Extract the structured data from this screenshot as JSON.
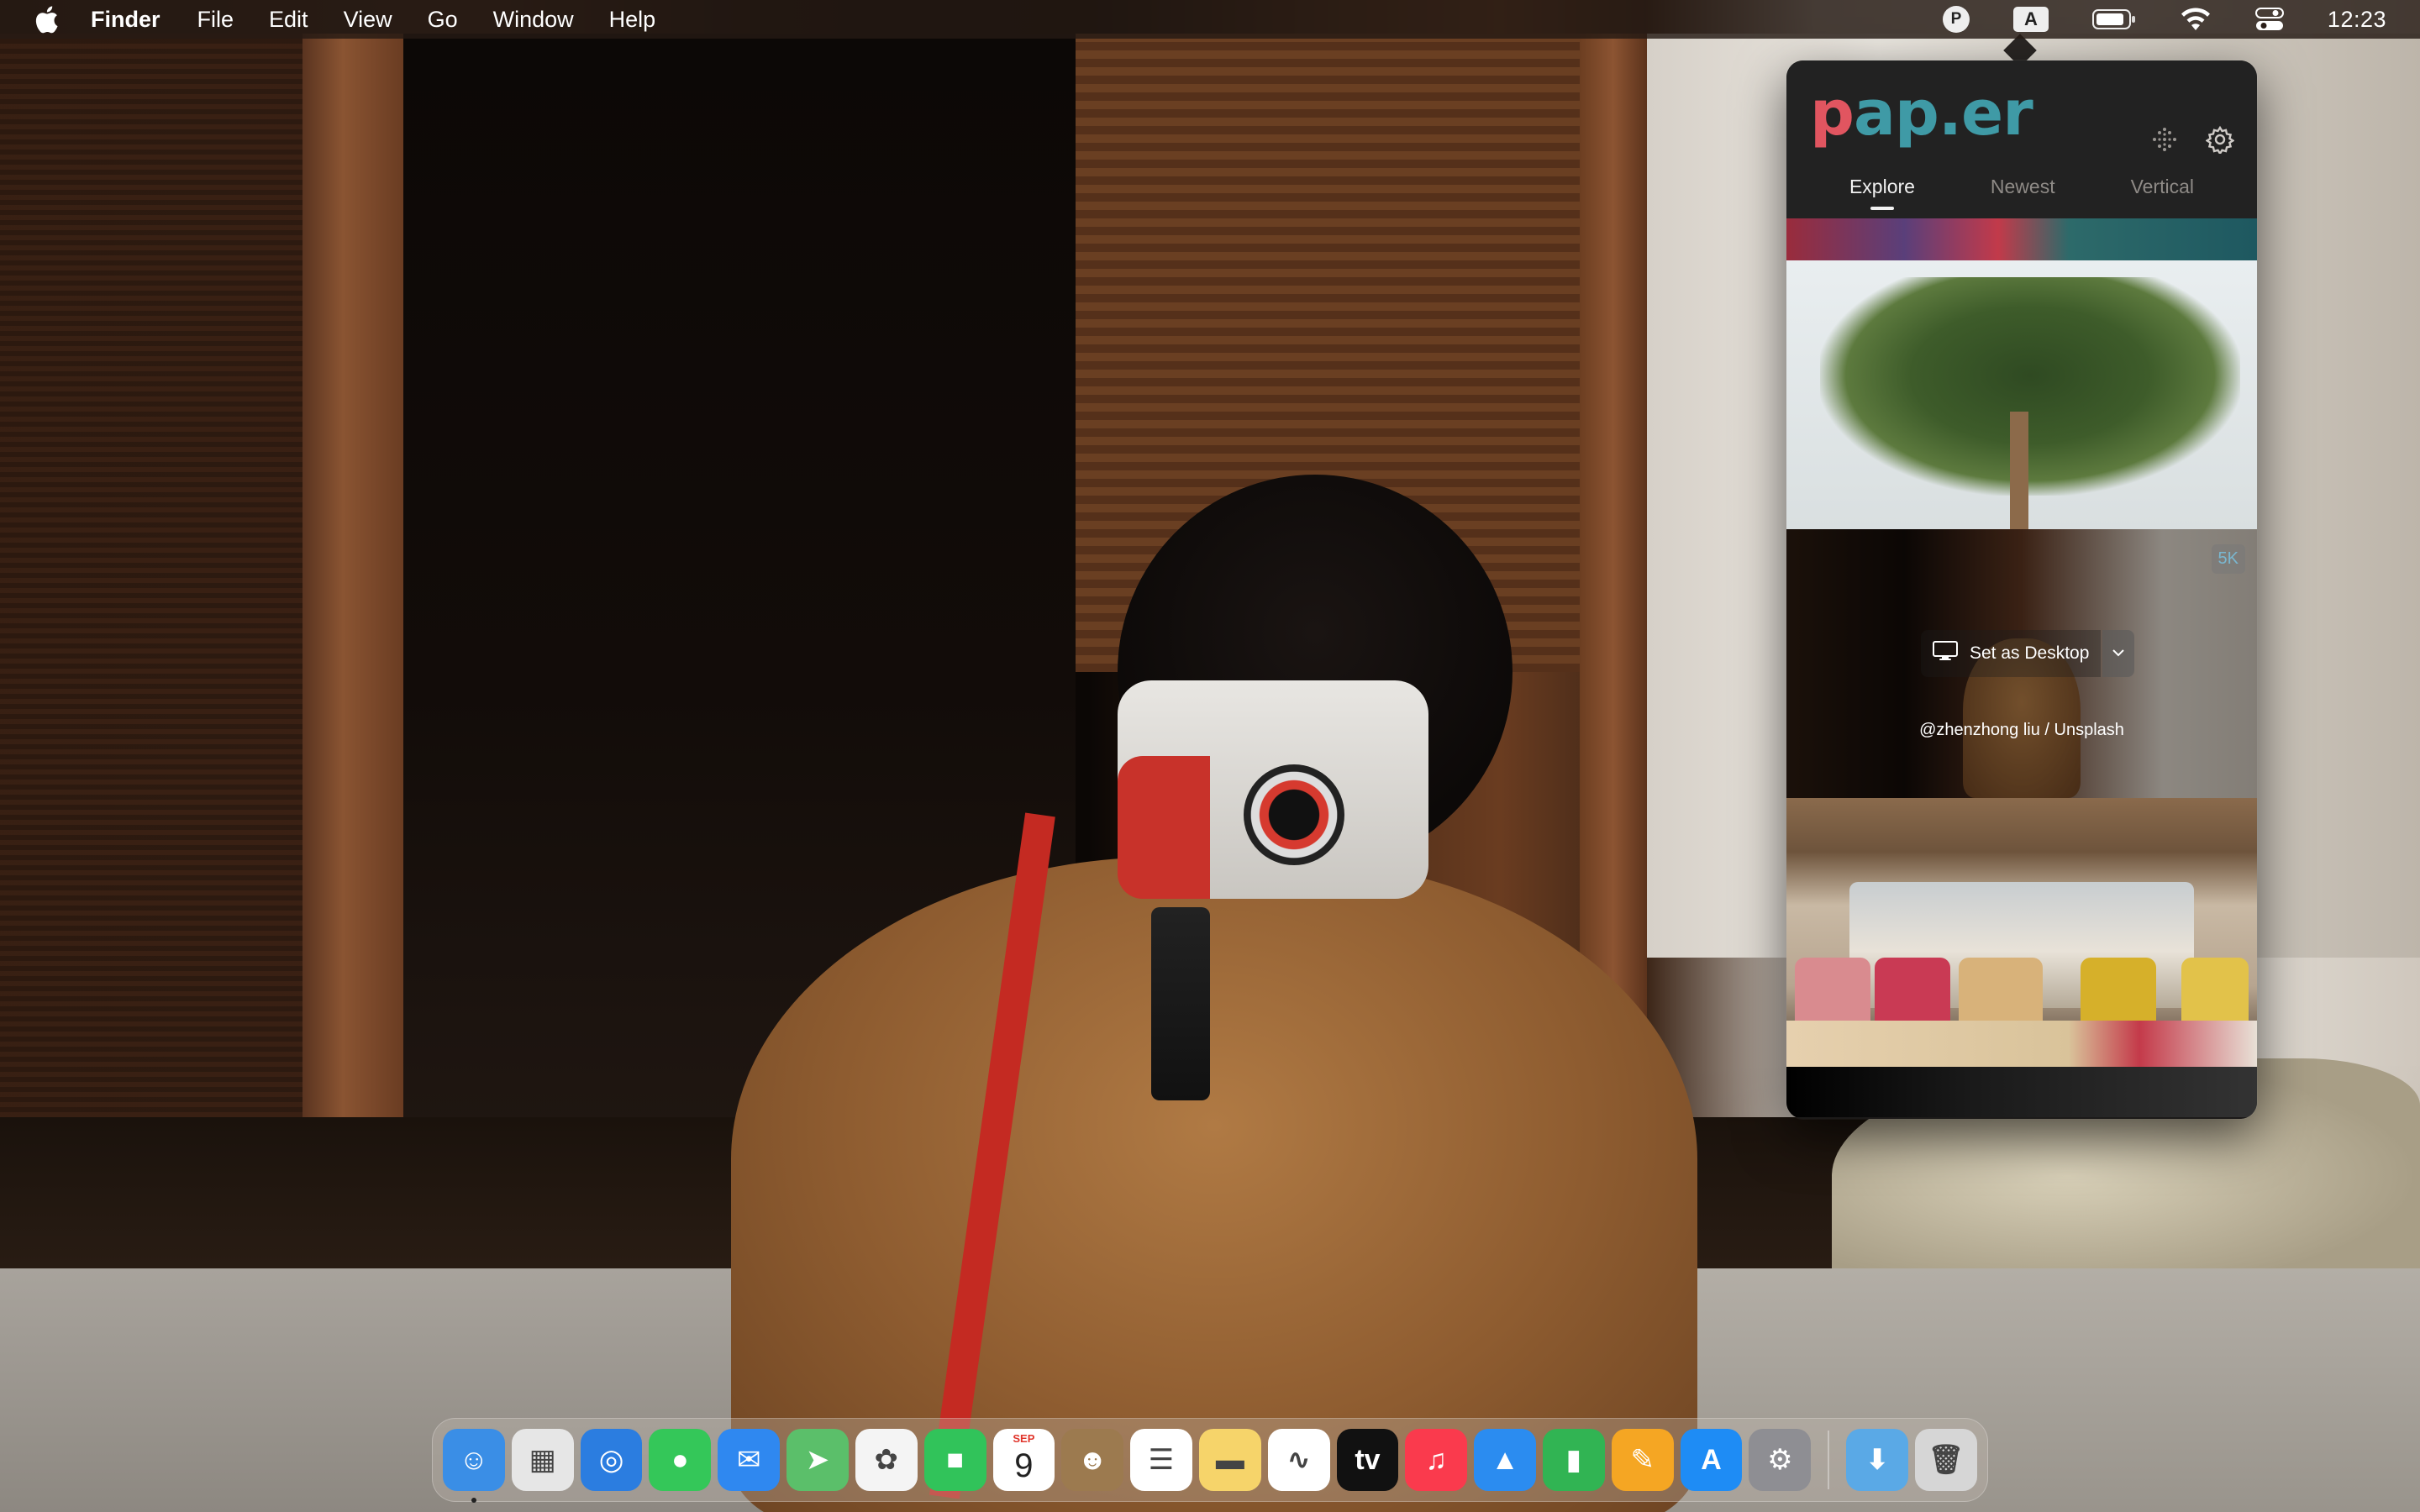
{
  "menubar": {
    "app_name": "Finder",
    "menus": [
      "File",
      "Edit",
      "View",
      "Go",
      "Window",
      "Help"
    ],
    "status": {
      "paper_badge": "P",
      "input_badge": "A",
      "clock": "12:23"
    }
  },
  "popover": {
    "logo": {
      "first": "p",
      "rest": "ap.er"
    },
    "tabs": [
      {
        "label": "Explore",
        "active": true
      },
      {
        "label": "Newest",
        "active": false
      },
      {
        "label": "Vertical",
        "active": false
      }
    ],
    "selected_thumb": {
      "resolution_badge": "5K",
      "set_desktop_label": "Set as Desktop",
      "credit": "@zhenzhong liu / Unsplash"
    }
  },
  "dock": {
    "apps": [
      {
        "name": "Finder",
        "icon": "finder-icon",
        "color": "#3a8ee6",
        "glyph": "☺"
      },
      {
        "name": "Launchpad",
        "icon": "launchpad-icon",
        "color": "#e6e6e6",
        "glyph": "▦"
      },
      {
        "name": "Safari",
        "icon": "safari-icon",
        "color": "#2b7de0",
        "glyph": "◎"
      },
      {
        "name": "Messages",
        "icon": "messages-icon",
        "color": "#34c759",
        "glyph": "●"
      },
      {
        "name": "Mail",
        "icon": "mail-icon",
        "color": "#2f88f0",
        "glyph": "✉"
      },
      {
        "name": "Maps",
        "icon": "maps-icon",
        "color": "#5bbf6a",
        "glyph": "➤"
      },
      {
        "name": "Photos",
        "icon": "photos-icon",
        "color": "#f4f4f4",
        "glyph": "✿"
      },
      {
        "name": "FaceTime",
        "icon": "facetime-icon",
        "color": "#31c35a",
        "glyph": "■"
      },
      {
        "name": "Calendar",
        "icon": "calendar-icon",
        "color": "#ffffff",
        "glyph": "9",
        "month": "SEP"
      },
      {
        "name": "Contacts",
        "icon": "contacts-icon",
        "color": "#9c7a4f",
        "glyph": "☻"
      },
      {
        "name": "Reminders",
        "icon": "reminders-icon",
        "color": "#ffffff",
        "glyph": "☰"
      },
      {
        "name": "Notes",
        "icon": "notes-icon",
        "color": "#f6d46a",
        "glyph": "▬"
      },
      {
        "name": "Freeform",
        "icon": "freeform-icon",
        "color": "#ffffff",
        "glyph": "∿"
      },
      {
        "name": "TV",
        "icon": "apple-tv-icon",
        "color": "#111111",
        "glyph": "tv"
      },
      {
        "name": "Music",
        "icon": "music-icon",
        "color": "#fa3a4d",
        "glyph": "♫"
      },
      {
        "name": "Keynote",
        "icon": "keynote-icon",
        "color": "#2b8cf0",
        "glyph": "▲"
      },
      {
        "name": "Numbers",
        "icon": "numbers-icon",
        "color": "#31b453",
        "glyph": "▮"
      },
      {
        "name": "Pages",
        "icon": "pages-icon",
        "color": "#f5a623",
        "glyph": "✎"
      },
      {
        "name": "App Store",
        "icon": "app-store-icon",
        "color": "#1e8cf5",
        "glyph": "A"
      },
      {
        "name": "System Settings",
        "icon": "system-settings-icon",
        "color": "#8e8e93",
        "glyph": "⚙"
      }
    ],
    "folders": [
      {
        "name": "Downloads",
        "icon": "downloads-folder-icon",
        "color": "#5aa9e6",
        "glyph": "⬇"
      },
      {
        "name": "Trash",
        "icon": "trash-icon",
        "color": "#d6d6d6",
        "glyph": "🗑"
      }
    ]
  }
}
